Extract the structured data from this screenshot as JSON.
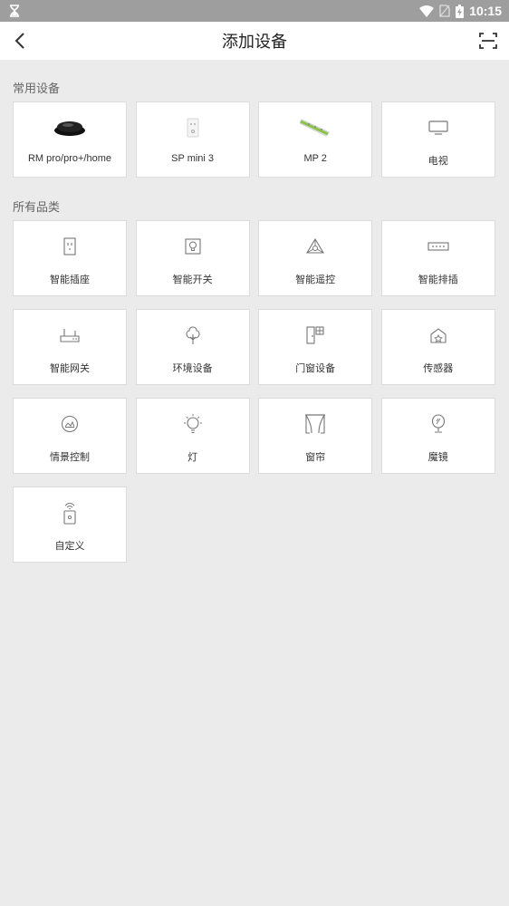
{
  "status_bar": {
    "time": "10:15"
  },
  "header": {
    "title": "添加设备"
  },
  "common_section": {
    "title": "常用设备",
    "items": [
      {
        "label": "RM pro/pro+/home",
        "icon": "rm-pro-device-icon"
      },
      {
        "label": "SP mini 3",
        "icon": "sp-mini-plug-icon"
      },
      {
        "label": "MP 2",
        "icon": "power-strip-icon"
      },
      {
        "label": "电视",
        "icon": "tv-icon"
      }
    ]
  },
  "all_section": {
    "title": "所有品类",
    "items": [
      {
        "label": "智能插座",
        "icon": "smart-socket-icon"
      },
      {
        "label": "智能开关",
        "icon": "smart-switch-icon"
      },
      {
        "label": "智能遥控",
        "icon": "smart-remote-icon"
      },
      {
        "label": "智能排插",
        "icon": "smart-strip-icon"
      },
      {
        "label": "智能网关",
        "icon": "gateway-icon"
      },
      {
        "label": "环境设备",
        "icon": "tree-icon"
      },
      {
        "label": "门窗设备",
        "icon": "door-window-icon"
      },
      {
        "label": "传感器",
        "icon": "sensor-house-icon"
      },
      {
        "label": "情景控制",
        "icon": "scene-icon"
      },
      {
        "label": "灯",
        "icon": "bulb-icon"
      },
      {
        "label": "窗帘",
        "icon": "curtain-icon"
      },
      {
        "label": "魔镜",
        "icon": "mirror-icon"
      },
      {
        "label": "自定义",
        "icon": "custom-remote-icon"
      }
    ]
  },
  "colors": {
    "status_bar": "#9e9e9e",
    "background": "#ebebeb",
    "card": "#ffffff",
    "mp2_accent": "#8bc34a"
  }
}
